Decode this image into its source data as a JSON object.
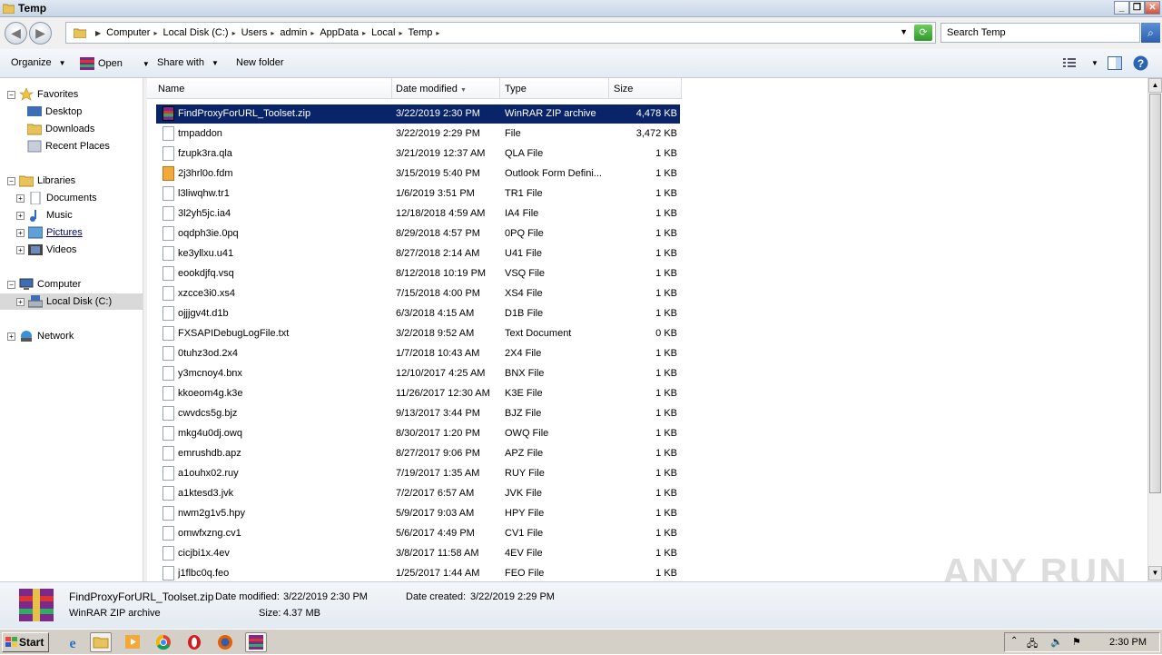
{
  "window": {
    "title": "Temp"
  },
  "address": {
    "crumbs": [
      "Computer",
      "Local Disk (C:)",
      "Users",
      "admin",
      "AppData",
      "Local",
      "Temp"
    ]
  },
  "search": {
    "placeholder": "Search Temp"
  },
  "toolbar": {
    "organize": "Organize",
    "open": "Open",
    "share_with": "Share with",
    "new_folder": "New folder"
  },
  "sidebar": {
    "favorites": "Favorites",
    "desktop": "Desktop",
    "downloads": "Downloads",
    "recent": "Recent Places",
    "libraries": "Libraries",
    "documents": "Documents",
    "music": "Music",
    "pictures": "Pictures",
    "videos": "Videos",
    "computer": "Computer",
    "local_disk": "Local Disk (C:)",
    "network": "Network"
  },
  "columns": {
    "name": "Name",
    "date": "Date modified",
    "type": "Type",
    "size": "Size"
  },
  "files": [
    {
      "name": "FindProxyForURL_Toolset.zip",
      "date": "3/22/2019 2:30 PM",
      "type": "WinRAR ZIP archive",
      "size": "4,478 KB"
    },
    {
      "name": "tmpaddon",
      "date": "3/22/2019 2:29 PM",
      "type": "File",
      "size": "3,472 KB"
    },
    {
      "name": "fzupk3ra.qla",
      "date": "3/21/2019 12:37 AM",
      "type": "QLA File",
      "size": "1 KB"
    },
    {
      "name": "2j3hrl0o.fdm",
      "date": "3/15/2019 5:40 PM",
      "type": "Outlook Form Defini...",
      "size": "1 KB"
    },
    {
      "name": "l3liwqhw.tr1",
      "date": "1/6/2019 3:51 PM",
      "type": "TR1 File",
      "size": "1 KB"
    },
    {
      "name": "3l2yh5jc.ia4",
      "date": "12/18/2018 4:59 AM",
      "type": "IA4 File",
      "size": "1 KB"
    },
    {
      "name": "oqdph3ie.0pq",
      "date": "8/29/2018 4:57 PM",
      "type": "0PQ File",
      "size": "1 KB"
    },
    {
      "name": "ke3yllxu.u41",
      "date": "8/27/2018 2:14 AM",
      "type": "U41 File",
      "size": "1 KB"
    },
    {
      "name": "eookdjfq.vsq",
      "date": "8/12/2018 10:19 PM",
      "type": "VSQ File",
      "size": "1 KB"
    },
    {
      "name": "xzcce3i0.xs4",
      "date": "7/15/2018 4:00 PM",
      "type": "XS4 File",
      "size": "1 KB"
    },
    {
      "name": "ojjjgv4t.d1b",
      "date": "6/3/2018 4:15 AM",
      "type": "D1B File",
      "size": "1 KB"
    },
    {
      "name": "FXSAPIDebugLogFile.txt",
      "date": "3/2/2018 9:52 AM",
      "type": "Text Document",
      "size": "0 KB"
    },
    {
      "name": "0tuhz3od.2x4",
      "date": "1/7/2018 10:43 AM",
      "type": "2X4 File",
      "size": "1 KB"
    },
    {
      "name": "y3mcnoy4.bnx",
      "date": "12/10/2017 4:25 AM",
      "type": "BNX File",
      "size": "1 KB"
    },
    {
      "name": "kkoeom4g.k3e",
      "date": "11/26/2017 12:30 AM",
      "type": "K3E File",
      "size": "1 KB"
    },
    {
      "name": "cwvdcs5g.bjz",
      "date": "9/13/2017 3:44 PM",
      "type": "BJZ File",
      "size": "1 KB"
    },
    {
      "name": "mkg4u0dj.owq",
      "date": "8/30/2017 1:20 PM",
      "type": "OWQ File",
      "size": "1 KB"
    },
    {
      "name": "emrushdb.apz",
      "date": "8/27/2017 9:06 PM",
      "type": "APZ File",
      "size": "1 KB"
    },
    {
      "name": "a1ouhx02.ruy",
      "date": "7/19/2017 1:35 AM",
      "type": "RUY File",
      "size": "1 KB"
    },
    {
      "name": "a1ktesd3.jvk",
      "date": "7/2/2017 6:57 AM",
      "type": "JVK File",
      "size": "1 KB"
    },
    {
      "name": "nwm2g1v5.hpy",
      "date": "5/9/2017 9:03 AM",
      "type": "HPY File",
      "size": "1 KB"
    },
    {
      "name": "omwfxzng.cv1",
      "date": "5/6/2017 4:49 PM",
      "type": "CV1 File",
      "size": "1 KB"
    },
    {
      "name": "cicjbi1x.4ev",
      "date": "3/8/2017 11:58 AM",
      "type": "4EV File",
      "size": "1 KB"
    },
    {
      "name": "j1flbc0q.feo",
      "date": "1/25/2017 1:44 AM",
      "type": "FEO File",
      "size": "1 KB"
    }
  ],
  "details": {
    "filename": "FindProxyForURL_Toolset.zip",
    "date_modified_label": "Date modified:",
    "date_modified": "3/22/2019 2:30 PM",
    "date_created_label": "Date created:",
    "date_created": "3/22/2019 2:29 PM",
    "type": "WinRAR ZIP archive",
    "size_label": "Size:",
    "size": "4.37 MB"
  },
  "taskbar": {
    "start": "Start",
    "clock": "2:30 PM"
  },
  "watermark": "ANY RUN",
  "colors": {
    "selection": "#0a246a",
    "toolbar": "#e3eaf2"
  }
}
